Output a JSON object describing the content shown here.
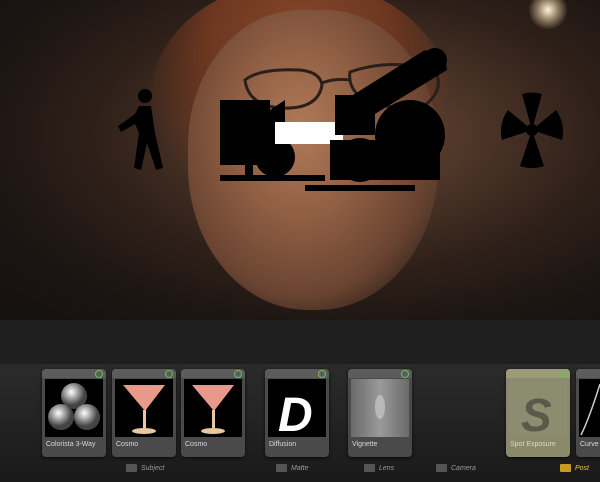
{
  "filters": {
    "cards": [
      {
        "label": "Colorista 3-Way",
        "icon": "three-spheres-icon"
      },
      {
        "label": "Cosmo",
        "icon": "cocktail-glass-icon"
      },
      {
        "label": "Cosmo",
        "icon": "cocktail-glass-icon"
      },
      {
        "label": "Diffusion",
        "icon": "letter-d-icon"
      },
      {
        "label": "Vignette",
        "icon": "vignette-icon"
      },
      {
        "label": "Spot Exposure",
        "icon": "letter-s-icon"
      },
      {
        "label": "Curve",
        "icon": "curve-icon"
      }
    ]
  },
  "tabs": {
    "subject": "Subject",
    "matte": "Matte",
    "lens": "Lens",
    "camera": "Camera",
    "post": "Post"
  },
  "colors": {
    "power": "#6ac24b",
    "active_tab": "#f0c040",
    "cocktail": "#e89a8a"
  }
}
